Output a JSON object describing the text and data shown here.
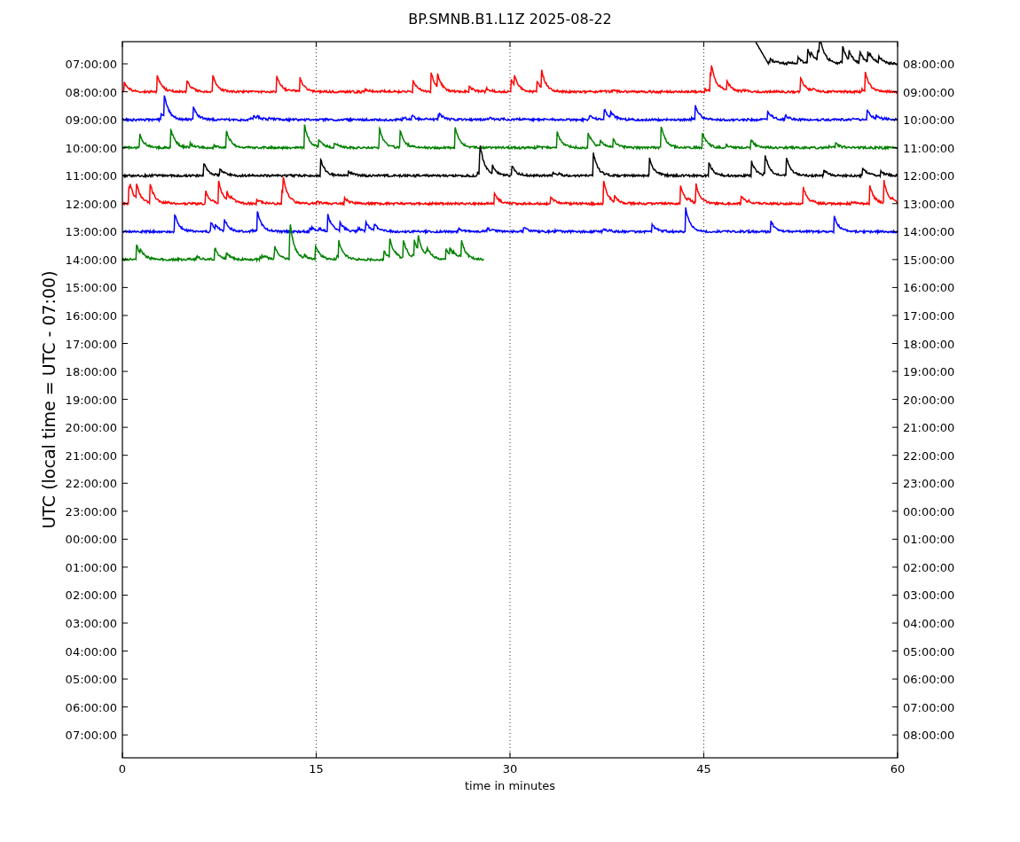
{
  "title": "BP.SMNB.B1.L1Z 2025-08-22",
  "xlabel": "time in minutes",
  "ylabel": "UTC (local time = UTC - 07:00)",
  "xticks": [
    "0",
    "15",
    "30",
    "45",
    "60"
  ],
  "rows": [
    {
      "left": "07:00:00",
      "right": "08:00:00",
      "color": "#000000"
    },
    {
      "left": "08:00:00",
      "right": "09:00:00",
      "color": "#ff0000"
    },
    {
      "left": "09:00:00",
      "right": "10:00:00",
      "color": "#0000ff"
    },
    {
      "left": "10:00:00",
      "right": "11:00:00",
      "color": "#008000"
    },
    {
      "left": "11:00:00",
      "right": "12:00:00",
      "color": "#000000"
    },
    {
      "left": "12:00:00",
      "right": "13:00:00",
      "color": "#ff0000"
    },
    {
      "left": "13:00:00",
      "right": "14:00:00",
      "color": "#0000ff"
    },
    {
      "left": "14:00:00",
      "right": "15:00:00",
      "color": "#008000"
    },
    {
      "left": "15:00:00",
      "right": "16:00:00"
    },
    {
      "left": "16:00:00",
      "right": "17:00:00"
    },
    {
      "left": "17:00:00",
      "right": "18:00:00"
    },
    {
      "left": "18:00:00",
      "right": "19:00:00"
    },
    {
      "left": "19:00:00",
      "right": "20:00:00"
    },
    {
      "left": "20:00:00",
      "right": "21:00:00"
    },
    {
      "left": "21:00:00",
      "right": "22:00:00"
    },
    {
      "left": "22:00:00",
      "right": "23:00:00"
    },
    {
      "left": "23:00:00",
      "right": "00:00:00"
    },
    {
      "left": "00:00:00",
      "right": "01:00:00"
    },
    {
      "left": "01:00:00",
      "right": "02:00:00"
    },
    {
      "left": "02:00:00",
      "right": "03:00:00"
    },
    {
      "left": "03:00:00",
      "right": "04:00:00"
    },
    {
      "left": "04:00:00",
      "right": "05:00:00"
    },
    {
      "left": "05:00:00",
      "right": "06:00:00"
    },
    {
      "left": "06:00:00",
      "right": "07:00:00"
    },
    {
      "left": "07:00:00",
      "right": "08:00:00"
    }
  ]
}
